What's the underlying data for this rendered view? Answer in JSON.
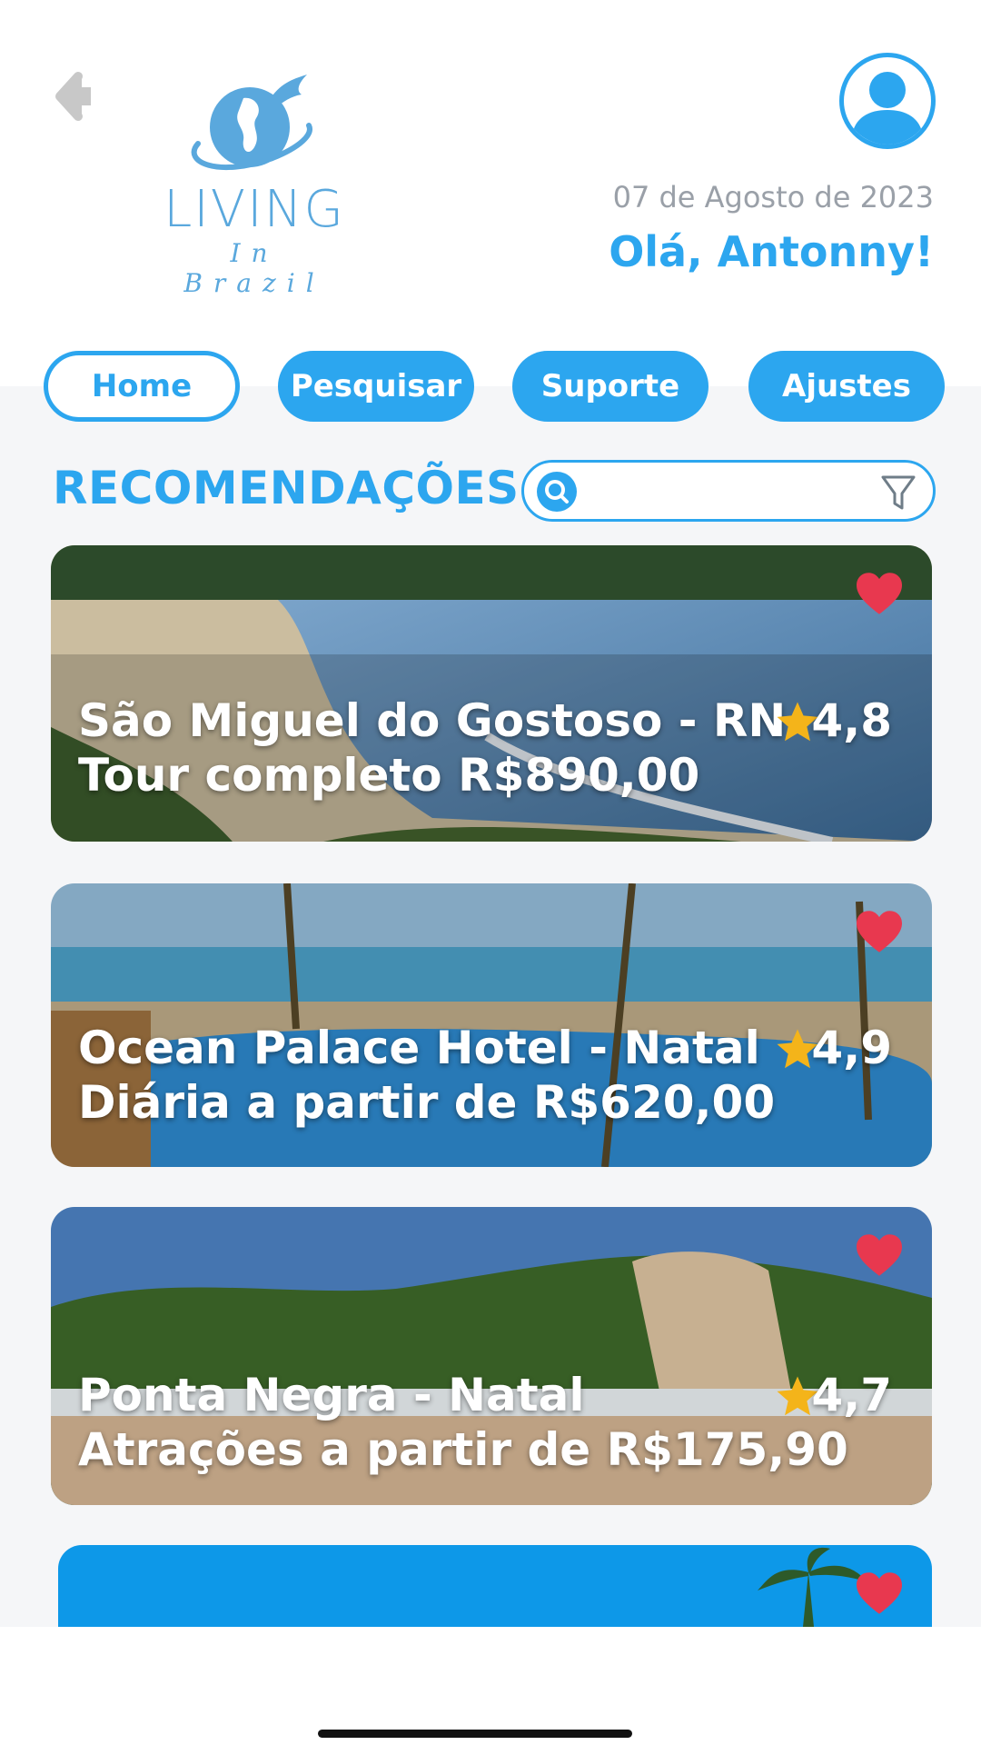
{
  "header": {
    "logo_line1": "LIVING",
    "logo_line2": "In Brazil",
    "date": "07 de Agosto de 2023",
    "greeting": "Olá, Antonny!"
  },
  "tabs": [
    {
      "label": "Home",
      "active": true
    },
    {
      "label": "Pesquisar",
      "active": false
    },
    {
      "label": "Suporte",
      "active": false
    },
    {
      "label": "Ajustes",
      "active": false
    }
  ],
  "section": {
    "title": "RECOMENDAÇÕES"
  },
  "search": {
    "value": "",
    "placeholder": ""
  },
  "cards": [
    {
      "title": "São Miguel do Gostoso - RN",
      "subtitle": "Tour completo R$890,00",
      "rating": "4,8",
      "favorite": true
    },
    {
      "title": "Ocean Palace Hotel - Natal",
      "subtitle": "Diária a partir de R$620,00",
      "rating": "4,9",
      "favorite": true
    },
    {
      "title": "Ponta Negra - Natal",
      "subtitle": "Atrações a partir de R$175,90",
      "rating": "4,7",
      "favorite": true
    },
    {
      "title": "",
      "subtitle": "",
      "rating": "",
      "favorite": true
    }
  ],
  "colors": {
    "accent": "#2ca6ef",
    "heart": "#e8384f",
    "star": "#f4b41a",
    "logo": "#5aa8dd"
  },
  "icons": [
    "back-arrow-icon",
    "globe-bird-logo",
    "user-avatar-icon",
    "search-icon",
    "filter-icon",
    "heart-icon",
    "star-icon"
  ]
}
